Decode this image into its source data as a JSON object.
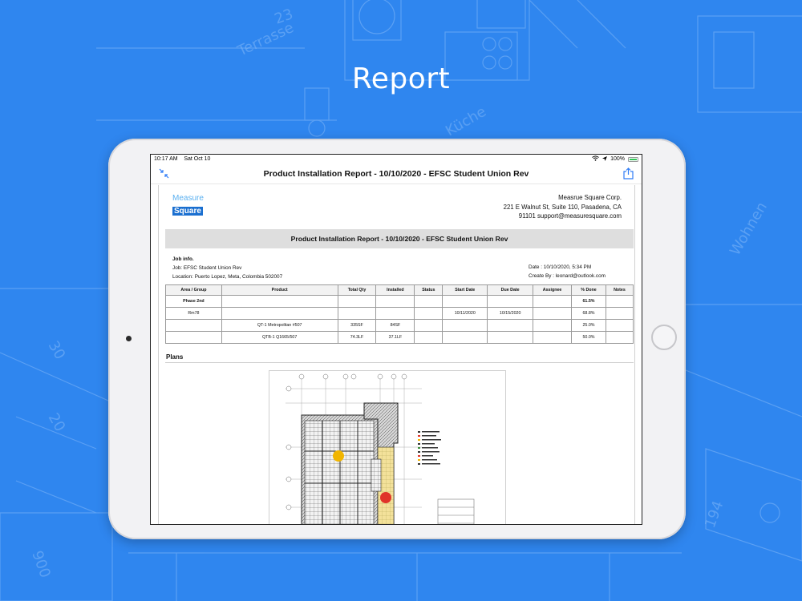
{
  "hero": {
    "title": "Report"
  },
  "status_bar": {
    "time": "10:17 AM",
    "date": "Sat Oct 10",
    "battery": "100%"
  },
  "nav": {
    "title": "Product Installation Report - 10/10/2020 - EFSC Student Union Rev"
  },
  "logo": {
    "line1": "Measure",
    "line2": "Square"
  },
  "company": {
    "name": "Measrue Square Corp.",
    "address": "221 E Walnut St, Suite 110, Pasadena, CA",
    "contact": "91101 support@measuresquare.com"
  },
  "report": {
    "title": "Product Installation Report - 10/10/2020 - EFSC Student Union Rev"
  },
  "job": {
    "header": "Job info.",
    "job_line": "Job: EFSC Student Union Rev",
    "location_line": "Location: Puerto Lopez, Meta, Colombia 502007",
    "date_line": "Date : 10/10/2020, 5:34 PM",
    "created_line": "Create By : leonard@outlook.com"
  },
  "table": {
    "headers": [
      "Area / Group",
      "Product",
      "Total Qty",
      "Installed",
      "Status",
      "Start Date",
      "Due Date",
      "Assignee",
      "% Done",
      "Notes"
    ],
    "rows": [
      [
        "Phase 2nd",
        "",
        "",
        "",
        "",
        "",
        "",
        "",
        "61.5%",
        ""
      ],
      [
        "Rm78",
        "",
        "",
        "",
        "",
        "10/11/2020",
        "10/15/2020",
        "",
        "68.8%",
        ""
      ],
      [
        "",
        "QT-1 Metropolitan #507",
        "335SF",
        "84SF",
        "",
        "",
        "",
        "",
        "25.0%",
        ""
      ],
      [
        "",
        "QTB-1 Q1665/507",
        "74.3LF",
        "37.1LF",
        "",
        "",
        "",
        "",
        "50.0%",
        ""
      ]
    ]
  },
  "plans": {
    "title": "Plans"
  },
  "colors": {
    "background": "#2f86ef",
    "accent": "#2f7cf6",
    "brand": "#1a6fd0"
  },
  "icons": {
    "nav_left": "collapse-arrows-icon",
    "nav_right": "share-icon"
  }
}
